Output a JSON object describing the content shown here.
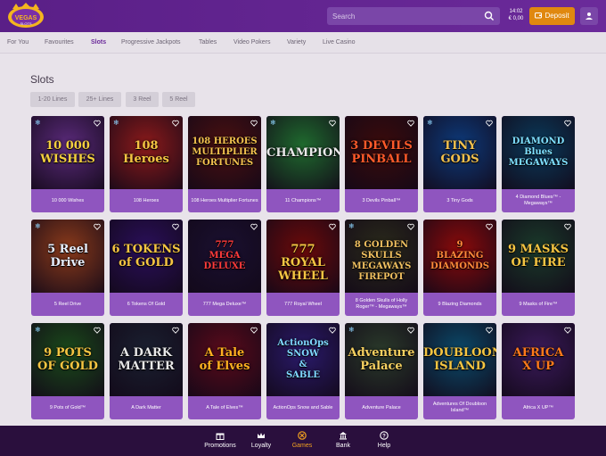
{
  "header": {
    "logo_text": "Vegas Slots",
    "search_placeholder": "Search",
    "time": "14:02",
    "balance": "€ 0,00",
    "deposit_label": "Deposit"
  },
  "nav": {
    "items": [
      "For You",
      "Favourites",
      "Slots",
      "Progressive Jackpots",
      "Tables",
      "Video Pokers",
      "Variety",
      "Live Casino"
    ],
    "active": "Slots"
  },
  "page_title": "Slots",
  "filters": [
    "1-20 Lines",
    "25+ Lines",
    "3 Reel",
    "5 Reel"
  ],
  "games": [
    {
      "name": "10 000 Wishes",
      "art": "10 000\nWISHES",
      "snow": true
    },
    {
      "name": "108 Heroes",
      "art": "108\nHeroes",
      "snow": true
    },
    {
      "name": "108 Heroes Multiplier Fortunes",
      "art": "108 HEROES\nMULTIPLIER\nFORTUNES",
      "snow": false
    },
    {
      "name": "11 Champions™",
      "art": "CHAMPIONS",
      "snow": true
    },
    {
      "name": "3 Devils Pinball™",
      "art": "3 DEVILS\nPINBALL",
      "snow": false
    },
    {
      "name": "3 Tiny Gods",
      "art": "TINY\nGODS",
      "snow": true
    },
    {
      "name": "4 Diamond Blues™ - Megaways™",
      "art": "DIAMOND\nBlues\nMEGAWAYS",
      "snow": false
    },
    {
      "name": "5 Reel Drive",
      "art": "5 Reel\nDrive",
      "snow": true
    },
    {
      "name": "6 Tokens Of Gold",
      "art": "6 TOKENS\nof GOLD",
      "snow": false
    },
    {
      "name": "777 Mega Deluxe™",
      "art": "777\nMEGA\nDELUXE",
      "snow": false
    },
    {
      "name": "777 Royal Wheel",
      "art": "777\nROYAL WHEEL",
      "snow": false
    },
    {
      "name": "8 Golden Skulls of Holly Roger™ - Megaways™",
      "art": "8 GOLDEN SKULLS\nMEGAWAYS\nFIREPOT",
      "snow": true
    },
    {
      "name": "9 Blazing Diamonds",
      "art": "9\nBLAZING\nDIAMONDS",
      "snow": false
    },
    {
      "name": "9 Masks of Fire™",
      "art": "9 MASKS\nOF FIRE",
      "snow": false
    },
    {
      "name": "9 Pots of Gold™",
      "art": "9 POTS\nOF GOLD",
      "snow": true
    },
    {
      "name": "A Dark Matter",
      "art": "A DARK\nMATTER",
      "snow": false
    },
    {
      "name": "A Tale of Elves™",
      "art": "A Tale\nof Elves",
      "snow": false
    },
    {
      "name": "ActionOps Snow and Sable",
      "art": "ActionOps\nSNOW\n&\nSABLE",
      "snow": false
    },
    {
      "name": "Adventure Palace",
      "art": "Adventure\nPalace",
      "snow": true
    },
    {
      "name": "Adventures Of Doubloon Island™",
      "art": "DOUBLOON\nISLAND",
      "snow": false
    },
    {
      "name": "Africa X UP™",
      "art": "AFRICA\nX UP",
      "snow": false
    }
  ],
  "bottom_nav": {
    "items": [
      "Promotions",
      "Loyalty",
      "Games",
      "Bank",
      "Help"
    ],
    "active": "Games"
  },
  "colors": {
    "header_bg": "#5a1f87",
    "accent": "#6b2a9a",
    "deposit": "#e0880f",
    "card_caption": "#8f55bf",
    "bottom_bar": "#2a0f3d",
    "active_bottom": "#f0a020"
  },
  "icons": {
    "search": "search-icon",
    "deposit": "wallet-icon",
    "profile": "user-icon",
    "favourite": "heart-icon",
    "seasonal": "snowflake-icon"
  }
}
